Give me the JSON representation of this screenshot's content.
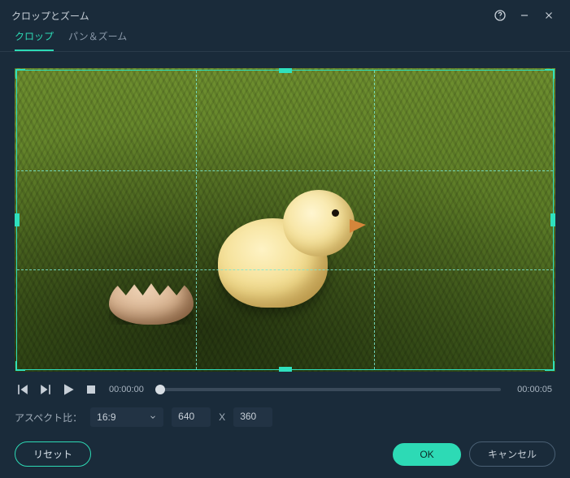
{
  "window": {
    "title": "クロップとズーム"
  },
  "tabs": {
    "crop": "クロップ",
    "panzoom": "パン＆ズーム",
    "active": 0
  },
  "playback": {
    "current": "00:00:00",
    "duration": "00:00:05"
  },
  "aspect": {
    "label": "アスペクト比：",
    "selected": "16:9",
    "width": "640",
    "sep": "X",
    "height": "360"
  },
  "buttons": {
    "reset": "リセット",
    "ok": "OK",
    "cancel": "キャンセル"
  }
}
